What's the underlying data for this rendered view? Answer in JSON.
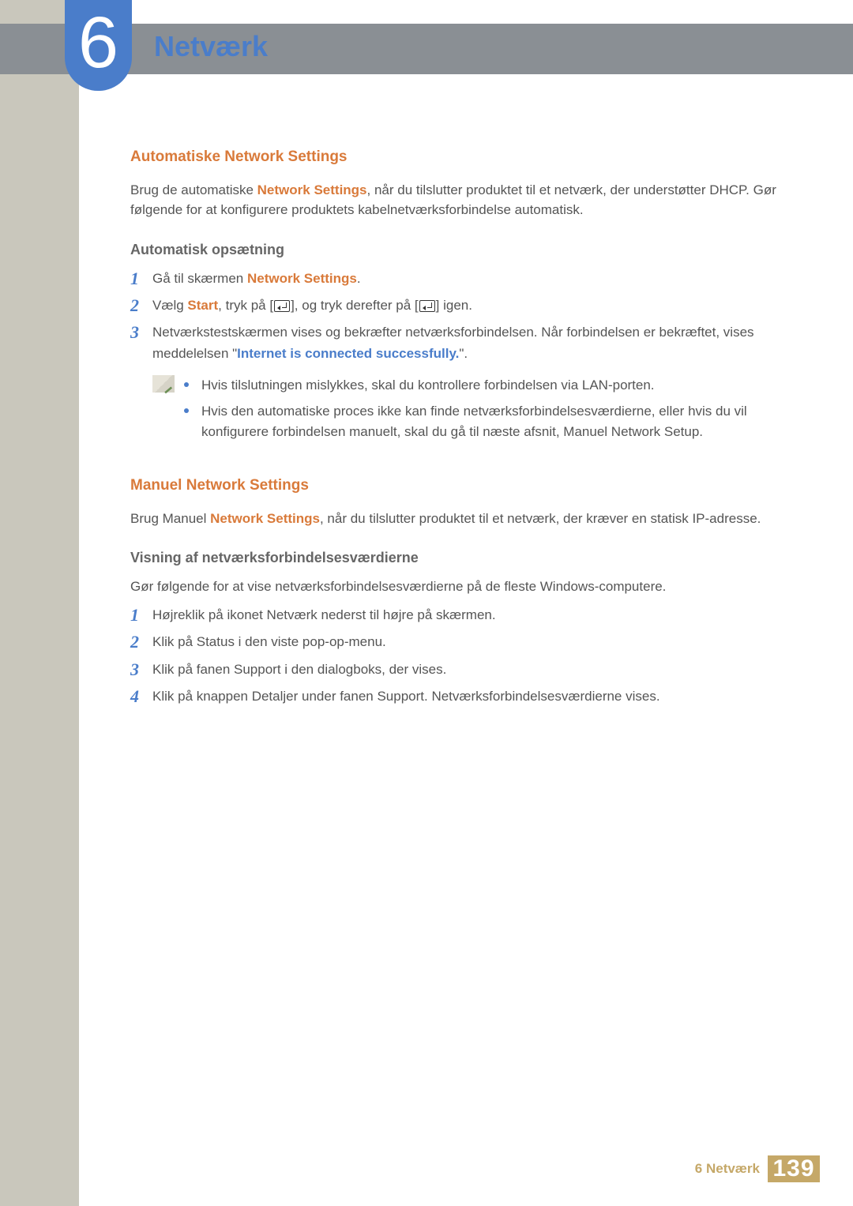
{
  "chapter": {
    "number": "6",
    "title": "Netværk"
  },
  "section_auto": {
    "heading": "Automatiske Network Settings",
    "intro_pre": "Brug de automatiske ",
    "intro_kw": "Network Settings",
    "intro_post": ", når du tilslutter produktet til et netværk, der understøtter DHCP. Gør følgende for at konfigurere produktets kabelnetværksforbindelse automatisk.",
    "sub": "Automatisk opsætning",
    "steps": [
      {
        "n": "1",
        "pre": "Gå til skærmen ",
        "kw": "Network Settings",
        "post": "."
      },
      {
        "n": "2",
        "pre": "Vælg ",
        "kw": "Start",
        "mid1": ", tryk på [",
        "mid2": "], og tryk derefter på [",
        "post": "] igen."
      },
      {
        "n": "3",
        "pre": "Netværkstestskærmen vises og bekræfter netværksforbindelsen. Når forbindelsen er bekræftet, vises meddelelsen \"",
        "kw": "Internet is connected successfully.",
        "post": "\"."
      }
    ],
    "notes": [
      "Hvis tilslutningen mislykkes, skal du kontrollere forbindelsen via LAN-porten.",
      "Hvis den automatiske proces ikke kan finde netværksforbindelsesværdierne, eller hvis du vil konfigurere forbindelsen manuelt, skal du gå til næste afsnit, Manuel Network Setup."
    ]
  },
  "section_manual": {
    "heading": "Manuel Network Settings",
    "intro_pre": "Brug Manuel ",
    "intro_kw": "Network Settings",
    "intro_post": ", når du tilslutter produktet til et netværk, der kræver en statisk IP-adresse.",
    "sub": "Visning af netværksforbindelsesværdierne",
    "sub_para": "Gør følgende for at vise netværksforbindelsesværdierne på de fleste Windows-computere.",
    "steps": [
      {
        "n": "1",
        "t": "Højreklik på ikonet Netværk nederst til højre på skærmen."
      },
      {
        "n": "2",
        "t": "Klik på Status i den viste pop-op-menu."
      },
      {
        "n": "3",
        "t": "Klik på fanen Support i den dialogboks, der vises."
      },
      {
        "n": "4",
        "t": "Klik på knappen Detaljer under fanen Support. Netværksforbindelsesværdierne vises."
      }
    ]
  },
  "footer": {
    "label": "6 Netværk",
    "page": "139"
  }
}
